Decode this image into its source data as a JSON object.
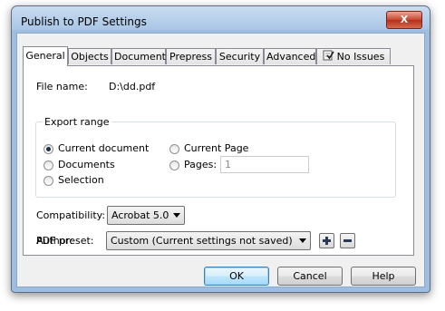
{
  "window": {
    "title": "Publish to PDF Settings",
    "close_label": "X"
  },
  "tabs": [
    {
      "label": "General",
      "active": true
    },
    {
      "label": "Objects"
    },
    {
      "label": "Document"
    },
    {
      "label": "Prepress"
    },
    {
      "label": "Security"
    },
    {
      "label": "Advanced"
    },
    {
      "label": "No Issues",
      "icon": "checklist-icon"
    }
  ],
  "general": {
    "file_name_label": "File name:",
    "file_name_value": "D:\\dd.pdf",
    "export_range": {
      "title": "Export range",
      "options": {
        "current_document": {
          "label": "Current document",
          "checked": true
        },
        "documents": {
          "label": "Documents",
          "checked": false
        },
        "selection": {
          "label": "Selection",
          "checked": false
        },
        "current_page": {
          "label": "Current Page",
          "checked": false
        },
        "pages": {
          "label": "Pages:",
          "checked": false
        }
      },
      "pages_value": "1"
    },
    "compatibility_label": "Compatibility:",
    "compatibility_value": "Acrobat 5.0",
    "author_label": "Author:",
    "author_value": "",
    "pdf_preset_label": "PDF preset:",
    "pdf_preset_value": "Custom (Current settings not saved)"
  },
  "buttons": {
    "ok": "OK",
    "cancel": "Cancel",
    "help": "Help"
  },
  "colors": {
    "title_bar": "#a9c6e6",
    "close_button": "#c9462e",
    "default_button_border": "#3c7fb1"
  }
}
